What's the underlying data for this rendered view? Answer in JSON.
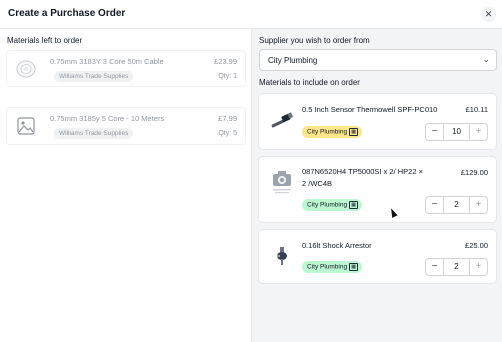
{
  "modal": {
    "title": "Create a Purchase Order",
    "close_icon": "close-icon"
  },
  "left": {
    "heading": "Materials left to order",
    "items": [
      {
        "name": "0.75mm 3183Y 3 Core 50m Cable",
        "price": "£23.99",
        "supplier": "Williams Trade Supplies",
        "qty": "Qty: 1",
        "icon": "cable-reel-icon"
      },
      {
        "name": "0.75mm 3185y 5 Core - 10 Meters",
        "price": "£7.99",
        "supplier": "Williams Trade Supplies",
        "qty": "Qty: 5",
        "icon": "image-placeholder-icon"
      }
    ]
  },
  "right": {
    "supplier_heading": "Supplier you wish to order from",
    "supplier_selected": "City Plumbing",
    "include_heading": "Materials to include on order",
    "items": [
      {
        "name": "0.5 Inch Sensor Thermowell SPF-PC010",
        "price": "£10.11",
        "supplier": "City Plumbing",
        "qty": "10",
        "icon": "thermowell-icon",
        "badge_color": "#fde68a"
      },
      {
        "name": "087N6520H4 TP5000SI x 2/ HP22 × 2 /WC4B",
        "price": "£129.00",
        "supplier": "City Plumbing",
        "qty": "2",
        "icon": "camera-placeholder-icon",
        "badge_color": "#bbf7d0"
      },
      {
        "name": "0.16lt Shock Arrestor",
        "price": "£25.00",
        "supplier": "City Plumbing",
        "qty": "2",
        "icon": "shock-arrestor-icon",
        "badge_color": "#bbf7d0"
      }
    ]
  },
  "stepper": {
    "minus": "−",
    "plus": "+"
  },
  "colors": {
    "panel_bg": "#f3f4f6",
    "badge_yellow": "#fde68a",
    "badge_green": "#bbf7d0"
  }
}
